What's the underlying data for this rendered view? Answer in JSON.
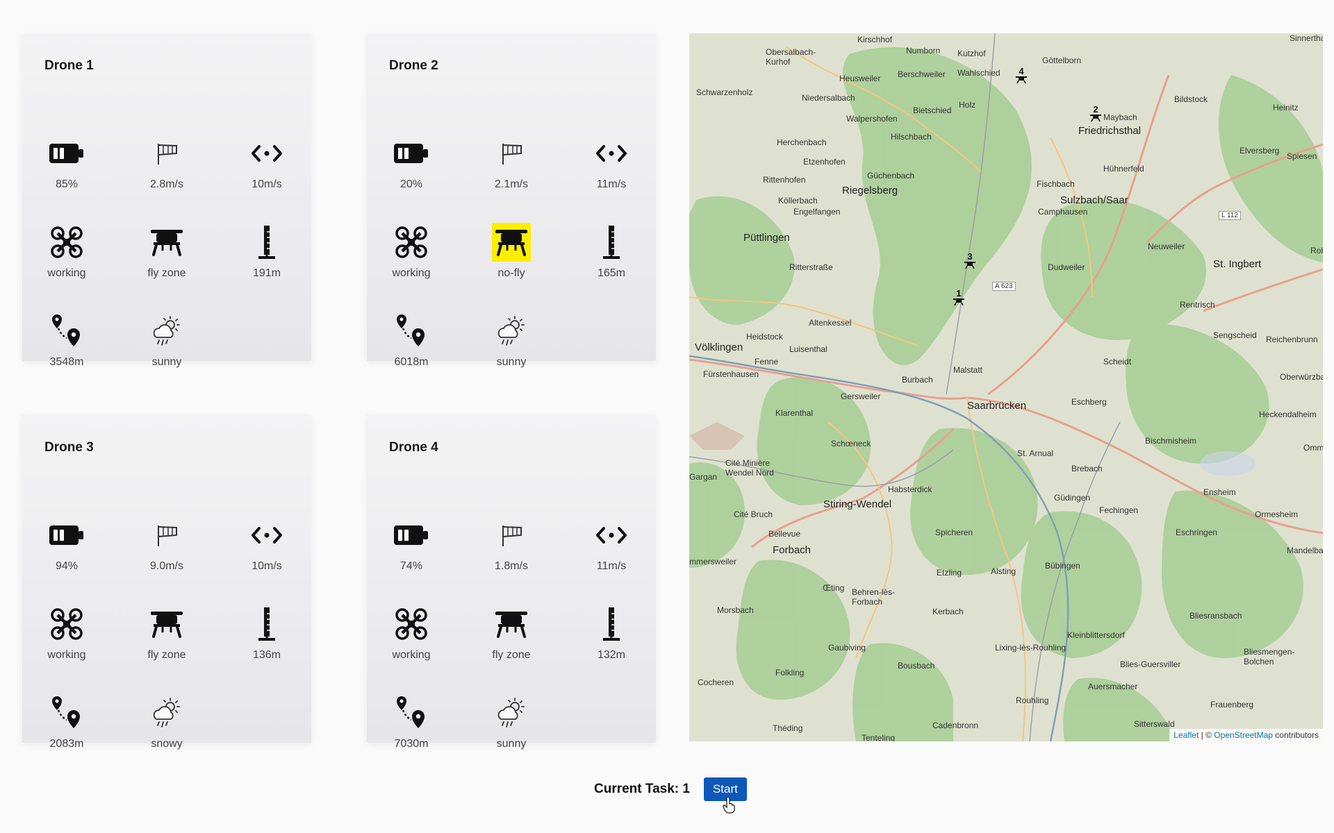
{
  "drones": [
    {
      "title": "Drone 1",
      "battery": "85%",
      "wind": "2.8m/s",
      "speed": "10m/s",
      "status": "working",
      "zone": "fly zone",
      "zone_alert": false,
      "altitude": "191m",
      "distance": "3548m",
      "weather": "sunny"
    },
    {
      "title": "Drone 2",
      "battery": "20%",
      "wind": "2.1m/s",
      "speed": "11m/s",
      "status": "working",
      "zone": "no-fly",
      "zone_alert": true,
      "altitude": "165m",
      "distance": "6018m",
      "weather": "sunny"
    },
    {
      "title": "Drone 3",
      "battery": "94%",
      "wind": "9.0m/s",
      "speed": "10m/s",
      "status": "working",
      "zone": "fly zone",
      "zone_alert": false,
      "altitude": "136m",
      "distance": "2083m",
      "weather": "snowy"
    },
    {
      "title": "Drone 4",
      "battery": "74%",
      "wind": "1.8m/s",
      "speed": "11m/s",
      "status": "working",
      "zone": "fly zone",
      "zone_alert": false,
      "altitude": "132m",
      "distance": "7030m",
      "weather": "sunny"
    }
  ],
  "icons": [
    "battery-icon",
    "wind-sock-icon",
    "speed-arrows-icon",
    "drone-icon",
    "drone-zone-icon",
    "altitude-icon",
    "route-distance-icon",
    "weather-icon"
  ],
  "map": {
    "places": {
      "saarbrucken": "Saarbrücken",
      "riegelsberg": "Riegelsberg",
      "puttlingen": "Püttlingen",
      "volklingen": "Völklingen",
      "sulzbach": "Sulzbach/Saar",
      "friedrichsthal": "Friedrichsthal",
      "st_ingbert": "St. Ingbert",
      "forbach": "Forbach",
      "stiring": "Stiring-Wendel",
      "malstatt": "Malstatt",
      "burbach": "Burbach",
      "eschberg": "Eschberg",
      "brebach": "Brebach",
      "st_arnual": "St. Arnual",
      "gudingen": "Güdingen",
      "bubingen": "Bübingen",
      "kirschhof": "Kirschhof",
      "numborn": "Numborn",
      "kutzhof": "Kutzhof",
      "heusweiler": "Heusweiler",
      "holz": "Holz",
      "dudweiler": "Dudweiler",
      "rentrisch": "Rentrisch",
      "scheidt": "Scheidt",
      "bischmisheim": "Bischmisheim",
      "ensheim": "Ensheim",
      "fechingen": "Fechingen",
      "spicheren": "Spicheren",
      "kleinblittersdorf": "Kleinblittersdorf",
      "bliesransbach": "Bliesransbach",
      "auersmacher": "Auersmacher",
      "folkling": "Folkling",
      "morsbach": "Morsbach",
      "habsterdick": "Habsterdick",
      "gersweiler": "Gersweiler",
      "klarenthal": "Klarenthal",
      "etzenhofen": "Etzenhofen",
      "herchenbach": "Herchenbach",
      "walpershofen": "Walpershofen",
      "neuweiler": "Neuweiler",
      "fischbach": "Fischbach",
      "camphausen": "Camphausen",
      "altenkessel": "Altenkessel",
      "heidstock": "Heidstock",
      "fenne": "Fenne",
      "luisenthal": "Luisenthal",
      "schoeneck": "Schœneck",
      "bellevue": "Bellevue",
      "cite_bruch": "Cité Bruch",
      "fuerstenhausen": "Fürstenhausen",
      "eschringen": "Eschringen",
      "ormesheim": "Ormesheim",
      "sengscheid": "Sengscheid",
      "reichenbrunn": "Reichenbrunn",
      "etzling": "Etzling",
      "alsting": "Alsting",
      "kerbach": "Kerbach",
      "bousbach": "Bousbach",
      "rouhling": "Rouhling",
      "theding": "Théding",
      "cadenbronn": "Cadenbronn",
      "sittersw": "Sitterswald",
      "frauenberg": "Frauenberg",
      "gaubiving": "Gaubiving",
      "cocheren": "Cocheren",
      "tenteling": "Tenteling",
      "elversberg": "Elversberg",
      "spiesen": "Spiesen",
      "heinitz": "Heinitz",
      "bildstock": "Bildstock",
      "maybach": "Maybach",
      "huhnerfeld": "Hühnerfeld",
      "gottelborn": "Göttelborn",
      "wahlschied": "Wahlschied",
      "berschweiler": "Berschweiler",
      "bietschied": "Bietschied",
      "hilschbach": "Hilschbach",
      "guchenbach": "Güchenbach",
      "kollerbach": "Köllerbach",
      "engelfangen": "Engelfangen",
      "rittenhofen": "Rittenhofen",
      "ritterstrasse": "Ritterstraße",
      "schwarzenholz": "Schwarzenholz",
      "niedersalbach": "Niedersalbach",
      "obersalbach": "Obersalbach-Kurhof",
      "oberwurzbach": "Oberwürzbach",
      "heckendalheim": "Heckendalheim",
      "mandelbach": "Mandelbach",
      "ommersheim": "Omme",
      "bliesmengen": "Bliesmengen-Bolchen",
      "bliesguersviller": "Blies-Guersviller",
      "lixing": "Lixing-lès-Rouhling",
      "behren": "Behren-lès-Forbach",
      "oeting": "Œting",
      "cite_miniere": "Cité Minière Wendel Nord",
      "gargan": "Gargan",
      "ommersweiler": "mmersweiler",
      "roh": "Roh",
      "sinnerthal": "Sinnerthal"
    },
    "road_labels": [
      "A 623",
      "L 112"
    ],
    "markers": [
      "1",
      "2",
      "3",
      "4"
    ],
    "attribution": {
      "leaflet": "Leaflet",
      "separator": " | © ",
      "osm": "OpenStreetMap",
      "contributors": " contributors"
    }
  },
  "footer": {
    "task_label": "Current Task: 1",
    "start_label": "Start"
  }
}
